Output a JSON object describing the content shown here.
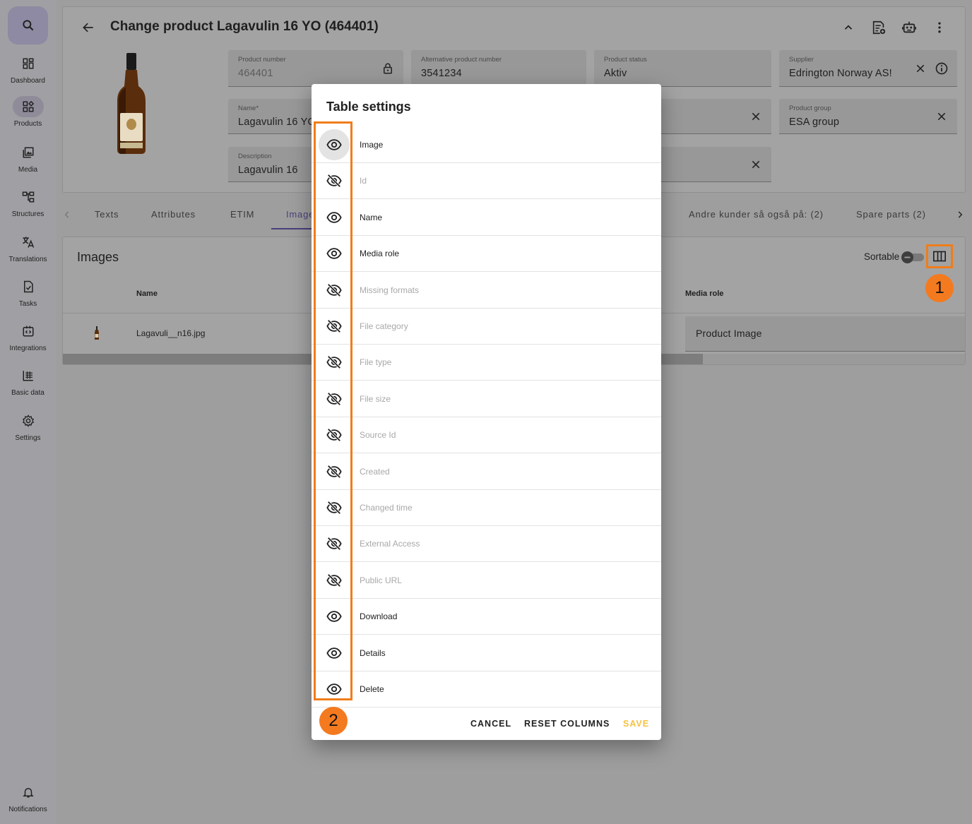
{
  "sidebar": {
    "search": "search-icon",
    "items": [
      {
        "label": "Dashboard",
        "icon": "dashboard-icon"
      },
      {
        "label": "Products",
        "icon": "products-icon",
        "active": true
      },
      {
        "label": "Media",
        "icon": "media-icon"
      },
      {
        "label": "Structures",
        "icon": "structures-icon"
      },
      {
        "label": "Translations",
        "icon": "translate-icon"
      },
      {
        "label": "Tasks",
        "icon": "tasks-icon"
      },
      {
        "label": "Integrations",
        "icon": "integrations-icon"
      },
      {
        "label": "Basic data",
        "icon": "basic-data-icon"
      },
      {
        "label": "Settings",
        "icon": "gear-icon"
      }
    ],
    "notifications": "Notifications"
  },
  "header": {
    "title": "Change product Lagavulin 16 YO (464401)"
  },
  "fields": {
    "product_number": {
      "label": "Product number",
      "value": "464401"
    },
    "alt_product_number": {
      "label": "Alternative product number",
      "value": "3541234"
    },
    "product_status": {
      "label": "Product status",
      "value": "Aktiv"
    },
    "supplier": {
      "label": "Supplier",
      "value": "Edrington Norway AS!"
    },
    "name": {
      "label": "Name*",
      "value": "Lagavulin 16 YO"
    },
    "product_group": {
      "label": "Product group",
      "value": "ESA group"
    },
    "description": {
      "label": "Description",
      "value": "Lagavulin 16"
    }
  },
  "tabs": [
    "Texts",
    "Attributes",
    "ETIM",
    "Images",
    "Andre kunder så også på: (2)",
    "Spare parts (2)"
  ],
  "images_section": {
    "title": "Images",
    "sortable_label": "Sortable",
    "sortable_on": false,
    "columns": {
      "name": "Name",
      "media_role": "Media role"
    },
    "rows": [
      {
        "name": "Lagavuli__n16.jpg",
        "media_role": "Product Image"
      }
    ]
  },
  "badges": {
    "one": "1",
    "two": "2"
  },
  "colors": {
    "accent_orange": "#f07d1a",
    "save_yellow": "#f5c242",
    "tab_active": "#4a3f7a"
  },
  "dialog": {
    "title": "Table settings",
    "rows": [
      {
        "label": "Image",
        "visible": true
      },
      {
        "label": "Id",
        "visible": false
      },
      {
        "label": "Name",
        "visible": true
      },
      {
        "label": "Media role",
        "visible": true
      },
      {
        "label": "Missing formats",
        "visible": false
      },
      {
        "label": "File category",
        "visible": false
      },
      {
        "label": "File type",
        "visible": false
      },
      {
        "label": "File size",
        "visible": false
      },
      {
        "label": "Source Id",
        "visible": false
      },
      {
        "label": "Created",
        "visible": false
      },
      {
        "label": "Changed time",
        "visible": false
      },
      {
        "label": "External Access",
        "visible": false
      },
      {
        "label": "Public URL",
        "visible": false
      },
      {
        "label": "Download",
        "visible": true
      },
      {
        "label": "Details",
        "visible": true
      },
      {
        "label": "Delete",
        "visible": true
      }
    ],
    "actions": {
      "cancel": "CANCEL",
      "reset": "RESET COLUMNS",
      "save": "SAVE"
    }
  }
}
